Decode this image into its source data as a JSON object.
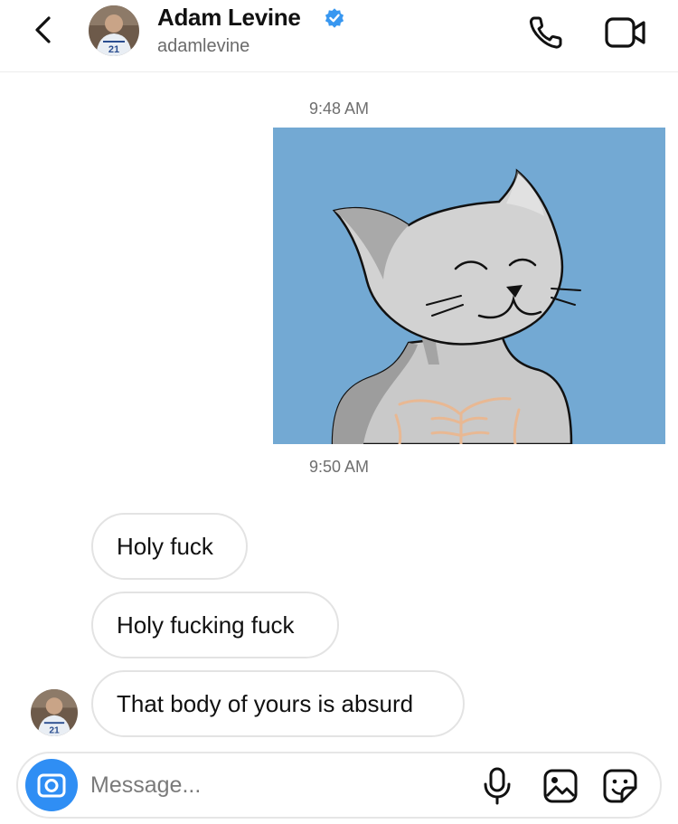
{
  "header": {
    "name": "Adam Levine",
    "handle": "adamlevine",
    "verified": true,
    "avatar_jersey_text": "21"
  },
  "messages": {
    "timestamp_1": "9:48 AM",
    "image_description": "cat-with-abs-drawing",
    "timestamp_2": "9:50 AM",
    "received": [
      "Holy fuck",
      "Holy fucking fuck",
      "That body of yours is absurd"
    ]
  },
  "composer": {
    "placeholder": "Message..."
  },
  "colors": {
    "accent": "#2f8ef4",
    "verified": "#3897f0",
    "image_bg": "#73a9d3"
  },
  "icons": {
    "back": "chevron-left-icon",
    "call": "phone-icon",
    "video": "video-camera-icon",
    "camera": "camera-icon",
    "mic": "microphone-icon",
    "gallery": "image-icon",
    "sticker": "sticker-icon"
  }
}
